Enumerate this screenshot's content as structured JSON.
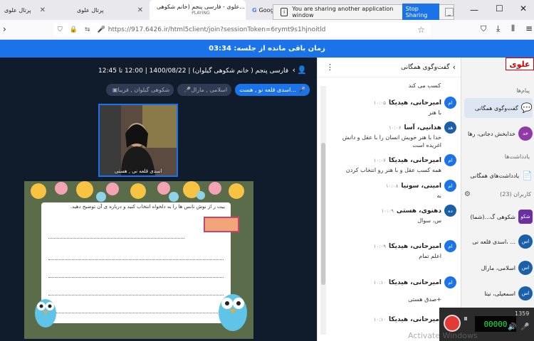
{
  "browser": {
    "tabs": [
      {
        "label": "پرتال علوی"
      },
      {
        "label": "پرتال علوی"
      },
      {
        "label": "علوی - فارسی پنجم (خانم شکوهی...",
        "sub": "PLAYING"
      },
      {
        "label": "Google"
      }
    ],
    "share_bar": {
      "message": "You are sharing another application window",
      "stop_label": "Stop Sharing"
    },
    "url": "https://917.6426.ir/html5client/join?sessionToken=6rymt9s1hjnoitld"
  },
  "session": {
    "remaining": "زمان باقی مانده از جلسه: 03:34"
  },
  "class": {
    "title": "فارسی پنجم ( خانم شکوهی گیلوان) | 1400/08/22 | 12:00 تا 12:45",
    "presenters": [
      "اسدی قلعه نو , هست...",
      "اسلامی , مارال",
      "شکوهی گیلوان , فریبا"
    ],
    "webcam_label": "اسدی قلعه نی , هستی",
    "slide_question": "بیت ر از نوش نانس ها را به دلخواه انتخاب  کنید و درباره ی آن توضیح دهید."
  },
  "chat": {
    "header": "گفت‌وگوی همگانی",
    "messages": [
      {
        "name": "",
        "time": "",
        "text": "کسب می کند",
        "avatar": "",
        "color": "#1a73e8"
      },
      {
        "name": "امیرحانی، هیدیکا",
        "time": "۱۰:۰۵",
        "text": "با هنر",
        "avatar": "ام",
        "color": "#1a73e8"
      },
      {
        "name": "هدانیی، آسا",
        "time": "۱۰:۰۶",
        "text": "خدا با هنر خویش انسان را با عقل و دانش اغریده است",
        "avatar": "هد",
        "color": "#1a5fa8"
      },
      {
        "name": "امیرحانی، هیدیکا",
        "time": "۱۰:۰۶",
        "text": "همه کسب عقل و با هنر رو انتخاب کردن",
        "avatar": "ام",
        "color": "#1a73e8"
      },
      {
        "name": "امینی، سونیا",
        "time": "۱۰:۰۸",
        "text": "به",
        "avatar": "ام",
        "color": "#1a73e8"
      },
      {
        "name": "دهنوی، هستی",
        "time": "۱۰:۰۹",
        "text": "س، سوال",
        "avatar": "ده",
        "color": "#1a5fa8"
      },
      {
        "name": "امیرحانی، هیدیکا",
        "time": "۱۰:۰۹",
        "text": "اعلم تمام",
        "avatar": "ام",
        "color": "#1a73e8"
      },
      {
        "name": "امیرحانی، هیدیکا",
        "time": "۱۰:۱۰",
        "text": "صدق هستی+",
        "avatar": "ام",
        "color": "#1a73e8"
      },
      {
        "name": "امیرحانی، هیدیکا",
        "time": "۱۰:۱۰",
        "text": "",
        "avatar": "ام",
        "color": "#1a73e8"
      }
    ]
  },
  "sidebar": {
    "logo": "علوی",
    "messages_section": "پیام‌ها",
    "public_chat": "گفت‌وگوی همگانی",
    "private_chat_user": "خدابخش دجانی، رها",
    "private_chat_avatar": "خد",
    "notes_section": "یادداشت‌ها",
    "shared_notes": "یادداشت‌های همگانی",
    "users_section": "کاربران (23)",
    "users": [
      {
        "name": "شکوهی گ...(شما)",
        "avatar": "شکو",
        "color": "#6a2fa0"
      },
      {
        "name": "اسدی قلعه نی، ...",
        "avatar": "اس",
        "color": "#1a5fa8"
      },
      {
        "name": "اسلامی، مارال",
        "avatar": "اس",
        "color": "#1a5fa8"
      },
      {
        "name": "اسمعیلی، نیتا",
        "avatar": "اس",
        "color": "#1a5fa8"
      }
    ]
  },
  "recorder": {
    "digits": "00000",
    "count": "1359"
  },
  "watermark": "Activate Windows"
}
